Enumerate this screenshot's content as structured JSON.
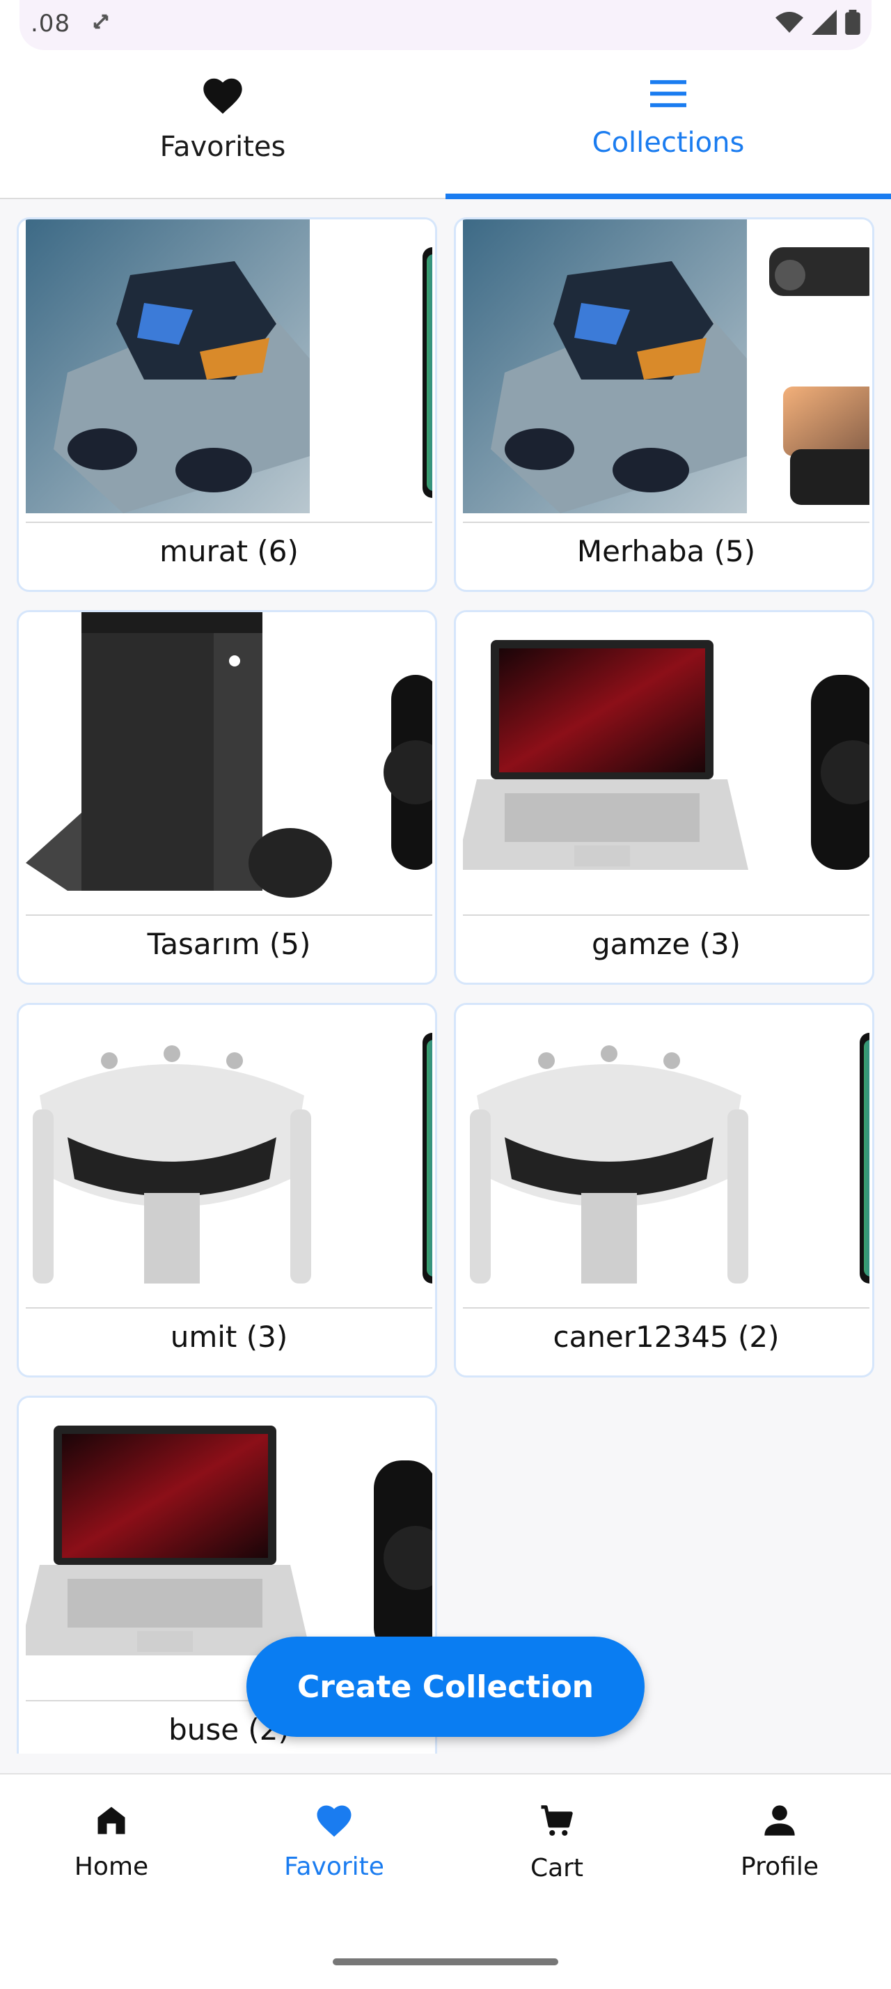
{
  "status_bar": {
    "time": ".08"
  },
  "tabs": [
    {
      "label": "Favorites",
      "icon": "heart-icon",
      "active": false
    },
    {
      "label": "Collections",
      "icon": "menu-icon",
      "active": true
    }
  ],
  "collections": [
    {
      "title": "murat (6)",
      "images": [
        "earbuds",
        "phone"
      ]
    },
    {
      "title": "Merhaba (5)",
      "images": [
        "earbuds",
        "drone"
      ]
    },
    {
      "title": "Tasarım (5)",
      "images": [
        "xbox-console",
        "smartwatch"
      ]
    },
    {
      "title": "gamze (3)",
      "images": [
        "laptop",
        "smartwatch"
      ]
    },
    {
      "title": "umit (3)",
      "images": [
        "vr-headset",
        "phone"
      ]
    },
    {
      "title": "caner12345 (2)",
      "images": [
        "vr-headset",
        "phone"
      ]
    },
    {
      "title": "buse (2)",
      "images": [
        "laptop",
        "smartwatch"
      ]
    }
  ],
  "fab": {
    "label": "Create Collection"
  },
  "bottom_nav": [
    {
      "label": "Home",
      "icon": "home-icon",
      "active": false
    },
    {
      "label": "Favorite",
      "icon": "heart-icon",
      "active": true
    },
    {
      "label": "Cart",
      "icon": "cart-icon",
      "active": false
    },
    {
      "label": "Profile",
      "icon": "person-icon",
      "active": false
    }
  ],
  "colors": {
    "accent": "#1a7cf0",
    "fab": "#0a7df2",
    "card_border": "#d6e6fb"
  }
}
